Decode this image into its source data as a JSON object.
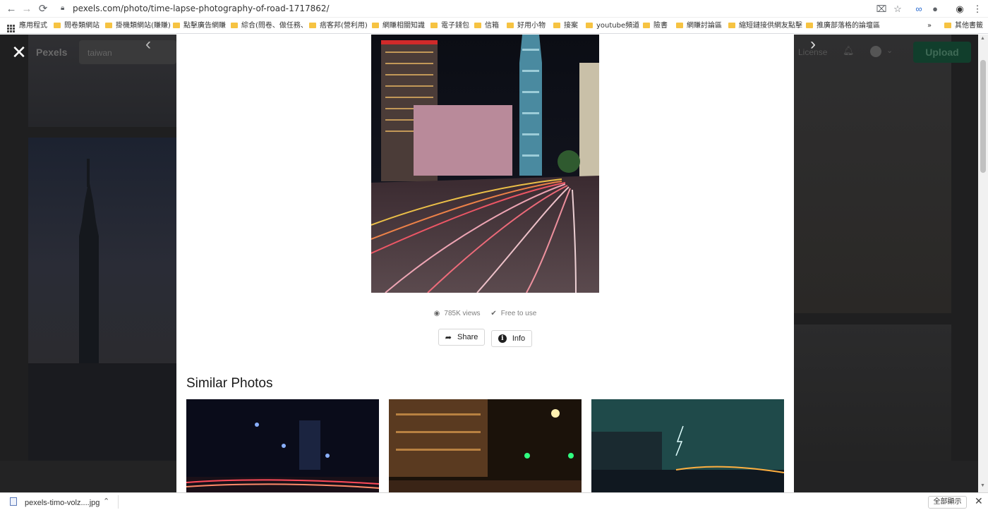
{
  "browser": {
    "url": "pexels.com/photo/time-lapse-photography-of-road-1717862/",
    "back_icon": "←",
    "forward_icon": "→",
    "reload_icon": "⟳",
    "bookmarks": [
      {
        "label": "應用程式",
        "type": "apps"
      },
      {
        "label": "問卷類網站",
        "type": "folder"
      },
      {
        "label": "掛機類網站(賺賺)",
        "type": "folder"
      },
      {
        "label": "點擊廣告網賺",
        "type": "folder"
      },
      {
        "label": "綜合(問卷、做任務、",
        "type": "folder"
      },
      {
        "label": "痞客邦(營利用)",
        "type": "folder"
      },
      {
        "label": "網賺相關知識",
        "type": "folder"
      },
      {
        "label": "電子錢包",
        "type": "folder"
      },
      {
        "label": "信箱",
        "type": "folder"
      },
      {
        "label": "好用小物",
        "type": "folder"
      },
      {
        "label": "接案",
        "type": "folder"
      },
      {
        "label": "youtube頻道",
        "type": "folder"
      },
      {
        "label": "險書",
        "type": "folder"
      },
      {
        "label": "網賺討論區",
        "type": "folder"
      },
      {
        "label": "縮短鏈接供網友點擊",
        "type": "folder"
      },
      {
        "label": "推廣部落格的論壇區",
        "type": "folder"
      }
    ],
    "more_bookmarks": "»",
    "other_bookmarks": "其他書籤"
  },
  "header": {
    "close_icon": "✕",
    "brand": "Pexels",
    "search_value": "taiwan",
    "prev_icon": "‹",
    "next_icon": "›",
    "license": "License",
    "upload": "Upload"
  },
  "photo": {
    "views": "785K views",
    "license_note": "Free to use",
    "share_label": "Share",
    "info_label": "Info"
  },
  "similar": {
    "title": "Similar Photos"
  },
  "downloads": {
    "file_name": "pexels-timo-volz....jpg",
    "show_all": "全部顯示"
  }
}
